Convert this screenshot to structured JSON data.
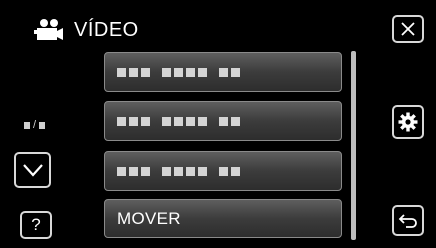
{
  "header": {
    "title": "VÍDEO",
    "icon": "video-camera-icon"
  },
  "menu": {
    "items": [
      {
        "label": "",
        "placeholder": true
      },
      {
        "label": "",
        "placeholder": true
      },
      {
        "label": "",
        "placeholder": true
      },
      {
        "label": "MOVER",
        "placeholder": false
      }
    ]
  },
  "controls": {
    "close_icon": "close-icon",
    "settings_icon": "gear-icon",
    "back_icon": "return-icon",
    "page_down_icon": "chevron-down-icon",
    "page_indicator_separator": "/",
    "help_label": "?"
  },
  "colors": {
    "background": "#000000",
    "button_border": "#d8d8d8",
    "menu_item_top": "#5e5e5e",
    "menu_item_bottom": "#2d2d2d",
    "scrollbar": "#bdbdbd",
    "text": "#ffffff"
  }
}
